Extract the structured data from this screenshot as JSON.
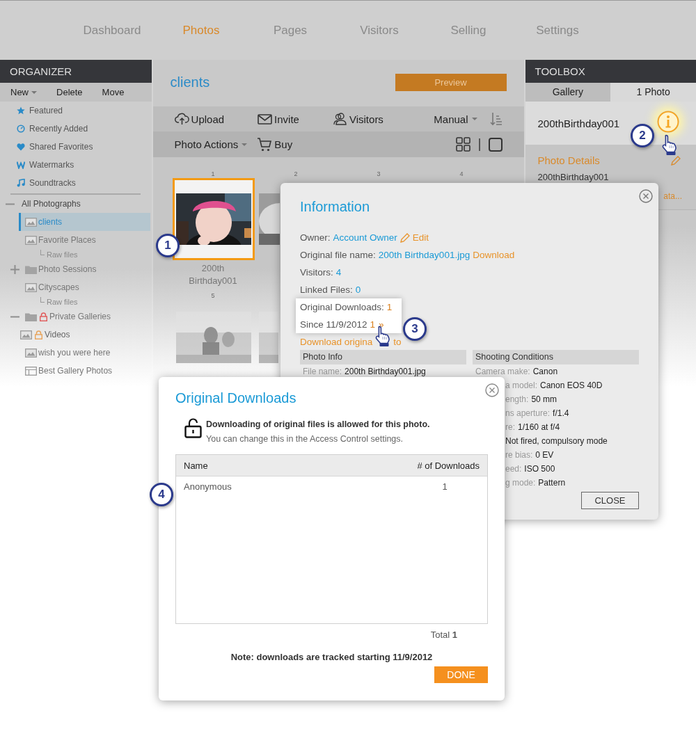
{
  "nav": [
    {
      "label": "Dashboard",
      "selected": false
    },
    {
      "label": "Photos",
      "selected": true
    },
    {
      "label": "Pages",
      "selected": false
    },
    {
      "label": "Visitors",
      "selected": false
    },
    {
      "label": "Selling",
      "selected": false
    },
    {
      "label": "Settings",
      "selected": false
    }
  ],
  "organizer": {
    "title": "ORGANIZER",
    "actions": [
      {
        "label": "New",
        "dropdown": true
      },
      {
        "label": "Delete",
        "dropdown": false
      },
      {
        "label": "Move",
        "dropdown": false
      }
    ],
    "shortcuts": [
      {
        "label": "Featured",
        "kind": "star",
        "selected": false
      },
      {
        "label": "Recently Added",
        "kind": "clock",
        "selected": false
      },
      {
        "label": "Shared Favorites",
        "kind": "heart",
        "selected": false
      },
      {
        "label": "Watermarks",
        "kind": "watermark",
        "selected": false
      },
      {
        "label": "Soundtracks",
        "kind": "music",
        "selected": false
      }
    ],
    "tree": [
      {
        "label": "All Photographs",
        "kind": "root",
        "expanded": true,
        "selected": false,
        "children": [
          {
            "label": "clients",
            "kind": "gallery",
            "selected": true
          },
          {
            "label": "Favorite Places",
            "kind": "gallery",
            "selected": false,
            "children": [
              {
                "label": "Raw files",
                "kind": "raw",
                "selected": false
              }
            ]
          },
          {
            "label": "Photo Sessions",
            "kind": "folder",
            "expanded": false,
            "selected": false
          },
          {
            "label": "Cityscapes",
            "kind": "gallery",
            "selected": false,
            "children": [
              {
                "label": "Raw files",
                "kind": "raw",
                "selected": false
              }
            ]
          },
          {
            "label": "Private Galleries",
            "kind": "folder",
            "locked": true,
            "expanded": true,
            "selected": false,
            "children": [
              {
                "label": "Videos",
                "kind": "gallery",
                "locked": true,
                "selected": false
              }
            ]
          },
          {
            "label": "wish you were here",
            "kind": "gallery",
            "selected": false
          },
          {
            "label": "Best Gallery Photos",
            "kind": "album",
            "selected": false
          }
        ]
      }
    ]
  },
  "gallery": {
    "title": "clients",
    "preview_button": "Preview",
    "toolbar": [
      {
        "label": "Upload",
        "kind": "upload"
      },
      {
        "label": "Invite",
        "kind": "invite"
      },
      {
        "label": "Visitors",
        "kind": "visitors"
      }
    ],
    "sort": "Manual",
    "photo_actions": "Photo Actions",
    "buy": "Buy",
    "view_modes": [
      {
        "kind": "grid"
      },
      {
        "kind": "single"
      }
    ],
    "column_numbers": [
      "1",
      "2",
      "3",
      "4"
    ],
    "photos": [
      {
        "kind": "picture",
        "selected": true,
        "caption": "200th Birthday001"
      },
      {
        "kind": "picture",
        "selected": false
      }
    ],
    "row_number": "5",
    "second_row": [
      {
        "kind": "picture"
      },
      {
        "kind": "picture"
      }
    ]
  },
  "toolbox": {
    "title": "TOOLBOX",
    "tabs": [
      {
        "label": "Gallery",
        "selected": false
      },
      {
        "label": "1 Photo",
        "selected": true
      }
    ],
    "photo_name": "200thBirthday001",
    "details_title": "Photo Details",
    "details_name": "200thBirthday001",
    "details_link": "ata..."
  },
  "information": {
    "title": "Information",
    "rows": [
      {
        "label": "Owner:",
        "value": "Account Owner",
        "action": "Edit",
        "editable": true
      },
      {
        "label": "Original file name:",
        "value": "200th Birthday001.jpg",
        "action": "Download",
        "editable": false
      },
      {
        "label": "Visitors:",
        "value": "4"
      },
      {
        "label": "Linked Files:",
        "value": "0"
      }
    ],
    "downloads_label": "Original Downloads:",
    "downloads_value": "1",
    "since_label": "Since 11/9/2012",
    "since_value": "1",
    "since_arrow": "»",
    "download_link": [
      "Download origina",
      "to"
    ],
    "photo_info": {
      "title": "Photo Info",
      "rows": [
        {
          "label": "File name:",
          "value": "200th Birthday001.jpg"
        }
      ]
    },
    "shooting": {
      "title": "Shooting Conditions",
      "rows": [
        {
          "label": "Camera make:",
          "value": "Canon",
          "cut": false
        },
        {
          "label": "a model:",
          "value": "Canon EOS 40D",
          "cut": true
        },
        {
          "label": "ength:",
          "value": "50 mm",
          "cut": true
        },
        {
          "label": "ns aperture:",
          "value": "f/1.4",
          "cut": true
        },
        {
          "label": "re:",
          "value": "1/160 at f/4",
          "cut": true
        },
        {
          "value": "Not fired, compulsory mode",
          "cut": true
        },
        {
          "label": "re bias:",
          "value": "0 EV",
          "cut": true
        },
        {
          "label": "eed:",
          "value": "ISO 500",
          "cut": true
        },
        {
          "label": "g mode:",
          "value": "Pattern",
          "cut": true
        }
      ]
    },
    "close_button": "CLOSE"
  },
  "downloads": {
    "title": "Original Downloads",
    "notice_bold": "Downloading of original files is allowed for this photo.",
    "notice": "You can change this in the Access Control settings.",
    "columns": [
      "Name",
      "# of Downloads"
    ],
    "rows": [
      [
        "Anonymous",
        "1"
      ]
    ],
    "total": "Total **1**",
    "note": "Note: downloads are tracked starting 11/9/2012",
    "done_button": "DONE"
  },
  "callouts": [
    "1",
    "2",
    "3",
    "4"
  ]
}
